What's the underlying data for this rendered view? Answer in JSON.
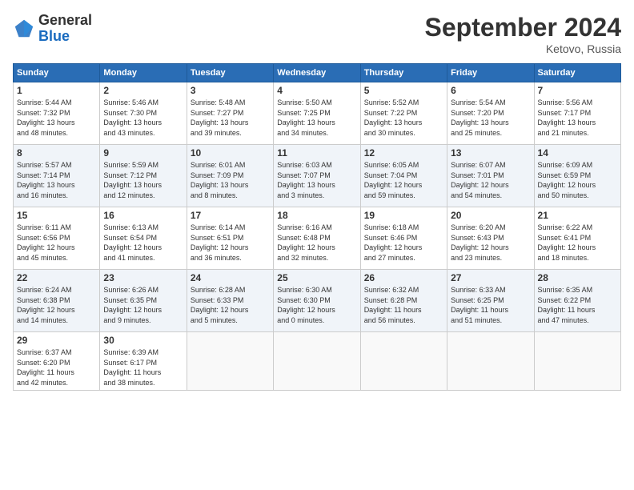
{
  "logo": {
    "general": "General",
    "blue": "Blue"
  },
  "title": "September 2024",
  "location": "Ketovo, Russia",
  "headers": [
    "Sunday",
    "Monday",
    "Tuesday",
    "Wednesday",
    "Thursday",
    "Friday",
    "Saturday"
  ],
  "weeks": [
    [
      {
        "day": "1",
        "info": "Sunrise: 5:44 AM\nSunset: 7:32 PM\nDaylight: 13 hours\nand 48 minutes."
      },
      {
        "day": "2",
        "info": "Sunrise: 5:46 AM\nSunset: 7:30 PM\nDaylight: 13 hours\nand 43 minutes."
      },
      {
        "day": "3",
        "info": "Sunrise: 5:48 AM\nSunset: 7:27 PM\nDaylight: 13 hours\nand 39 minutes."
      },
      {
        "day": "4",
        "info": "Sunrise: 5:50 AM\nSunset: 7:25 PM\nDaylight: 13 hours\nand 34 minutes."
      },
      {
        "day": "5",
        "info": "Sunrise: 5:52 AM\nSunset: 7:22 PM\nDaylight: 13 hours\nand 30 minutes."
      },
      {
        "day": "6",
        "info": "Sunrise: 5:54 AM\nSunset: 7:20 PM\nDaylight: 13 hours\nand 25 minutes."
      },
      {
        "day": "7",
        "info": "Sunrise: 5:56 AM\nSunset: 7:17 PM\nDaylight: 13 hours\nand 21 minutes."
      }
    ],
    [
      {
        "day": "8",
        "info": "Sunrise: 5:57 AM\nSunset: 7:14 PM\nDaylight: 13 hours\nand 16 minutes."
      },
      {
        "day": "9",
        "info": "Sunrise: 5:59 AM\nSunset: 7:12 PM\nDaylight: 13 hours\nand 12 minutes."
      },
      {
        "day": "10",
        "info": "Sunrise: 6:01 AM\nSunset: 7:09 PM\nDaylight: 13 hours\nand 8 minutes."
      },
      {
        "day": "11",
        "info": "Sunrise: 6:03 AM\nSunset: 7:07 PM\nDaylight: 13 hours\nand 3 minutes."
      },
      {
        "day": "12",
        "info": "Sunrise: 6:05 AM\nSunset: 7:04 PM\nDaylight: 12 hours\nand 59 minutes."
      },
      {
        "day": "13",
        "info": "Sunrise: 6:07 AM\nSunset: 7:01 PM\nDaylight: 12 hours\nand 54 minutes."
      },
      {
        "day": "14",
        "info": "Sunrise: 6:09 AM\nSunset: 6:59 PM\nDaylight: 12 hours\nand 50 minutes."
      }
    ],
    [
      {
        "day": "15",
        "info": "Sunrise: 6:11 AM\nSunset: 6:56 PM\nDaylight: 12 hours\nand 45 minutes."
      },
      {
        "day": "16",
        "info": "Sunrise: 6:13 AM\nSunset: 6:54 PM\nDaylight: 12 hours\nand 41 minutes."
      },
      {
        "day": "17",
        "info": "Sunrise: 6:14 AM\nSunset: 6:51 PM\nDaylight: 12 hours\nand 36 minutes."
      },
      {
        "day": "18",
        "info": "Sunrise: 6:16 AM\nSunset: 6:48 PM\nDaylight: 12 hours\nand 32 minutes."
      },
      {
        "day": "19",
        "info": "Sunrise: 6:18 AM\nSunset: 6:46 PM\nDaylight: 12 hours\nand 27 minutes."
      },
      {
        "day": "20",
        "info": "Sunrise: 6:20 AM\nSunset: 6:43 PM\nDaylight: 12 hours\nand 23 minutes."
      },
      {
        "day": "21",
        "info": "Sunrise: 6:22 AM\nSunset: 6:41 PM\nDaylight: 12 hours\nand 18 minutes."
      }
    ],
    [
      {
        "day": "22",
        "info": "Sunrise: 6:24 AM\nSunset: 6:38 PM\nDaylight: 12 hours\nand 14 minutes."
      },
      {
        "day": "23",
        "info": "Sunrise: 6:26 AM\nSunset: 6:35 PM\nDaylight: 12 hours\nand 9 minutes."
      },
      {
        "day": "24",
        "info": "Sunrise: 6:28 AM\nSunset: 6:33 PM\nDaylight: 12 hours\nand 5 minutes."
      },
      {
        "day": "25",
        "info": "Sunrise: 6:30 AM\nSunset: 6:30 PM\nDaylight: 12 hours\nand 0 minutes."
      },
      {
        "day": "26",
        "info": "Sunrise: 6:32 AM\nSunset: 6:28 PM\nDaylight: 11 hours\nand 56 minutes."
      },
      {
        "day": "27",
        "info": "Sunrise: 6:33 AM\nSunset: 6:25 PM\nDaylight: 11 hours\nand 51 minutes."
      },
      {
        "day": "28",
        "info": "Sunrise: 6:35 AM\nSunset: 6:22 PM\nDaylight: 11 hours\nand 47 minutes."
      }
    ],
    [
      {
        "day": "29",
        "info": "Sunrise: 6:37 AM\nSunset: 6:20 PM\nDaylight: 11 hours\nand 42 minutes."
      },
      {
        "day": "30",
        "info": "Sunrise: 6:39 AM\nSunset: 6:17 PM\nDaylight: 11 hours\nand 38 minutes."
      },
      {
        "day": "",
        "info": ""
      },
      {
        "day": "",
        "info": ""
      },
      {
        "day": "",
        "info": ""
      },
      {
        "day": "",
        "info": ""
      },
      {
        "day": "",
        "info": ""
      }
    ]
  ]
}
